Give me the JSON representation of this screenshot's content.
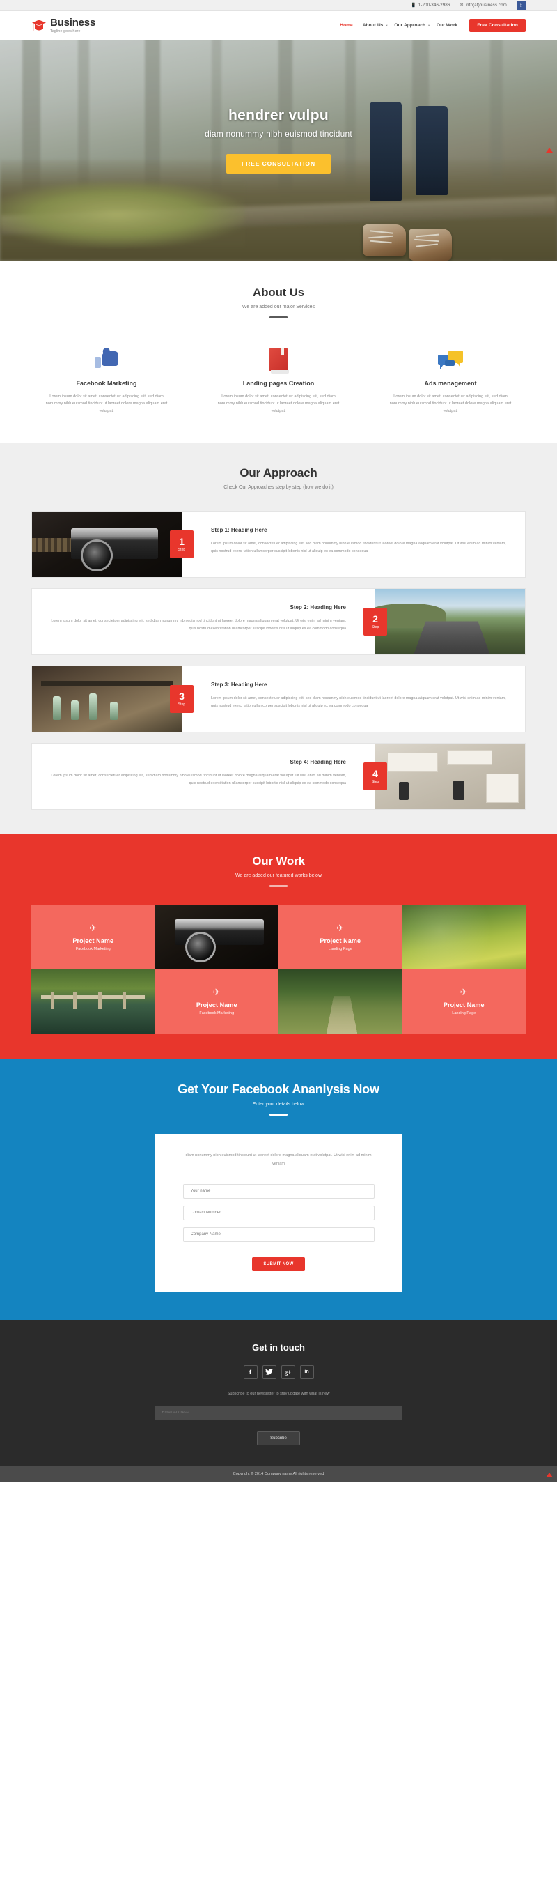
{
  "topbar": {
    "phone": "1-200-346-2986",
    "email": "info(at)business.com",
    "phone_icon": "mobile-icon",
    "email_icon": "envelope-icon",
    "facebook_icon": "f"
  },
  "header": {
    "brand_name": "Business",
    "tagline": "Tagline goes here",
    "nav": [
      {
        "label": "Home",
        "active": true,
        "caret": false
      },
      {
        "label": "About Us",
        "active": false,
        "caret": true
      },
      {
        "label": "Our Approach",
        "active": false,
        "caret": true
      },
      {
        "label": "Our Work",
        "active": false,
        "caret": false
      }
    ],
    "cta_label": "Free Consultation"
  },
  "hero": {
    "title": "hendrer vulpu",
    "subtitle": "diam nonummy nibh euismod tincidunt",
    "button": "FREE CONSULTATION"
  },
  "about": {
    "title": "About Us",
    "subtitle": "We are added our major Services",
    "columns": [
      {
        "icon": "thumbs-up-icon",
        "heading": "Facebook Marketing",
        "body": "Lorem ipsum dolor sit amet, consectetuer adipiscing elit, sed diam nonummy nibh euismod tincidunt ut laoreet dolore magna aliquam erat volutpat."
      },
      {
        "icon": "book-icon",
        "heading": "Landing pages Creation",
        "body": "Lorem ipsum dolor sit amet, consectetuer adipiscing elit, sed diam nonummy nibh euismod tincidunt ut laoreet dolore magna aliquam erat volutpat."
      },
      {
        "icon": "speech-bubbles-icon",
        "heading": "Ads management",
        "body": "Lorem ipsum dolor sit amet, consectetuer adipiscing elit, sed diam nonummy nibh euismod tincidunt ut laoreet dolore magna aliquam erat volutpat."
      }
    ]
  },
  "approach": {
    "title": "Our Approach",
    "subtitle": "Check Our Approaches step by step (how we do it)",
    "step_label": "Step",
    "steps": [
      {
        "number": "1",
        "heading": "Step 1: Heading Here",
        "body": "Lorem ipsum dolor sit amet, consectetuer adipiscing elit, sed diam nonummy nibh euismod tincidunt ut laoreet dolore magna aliquam erat volutpat. Ut wisi enim ad minim veniam, quis nostrud exerci tation ullamcorper suscipit lobortis nisl ut aliquip ex ea commodo consequa",
        "image": "vintage-camera-photo"
      },
      {
        "number": "2",
        "heading": "Step 2: Heading Here",
        "body": "Lorem ipsum dolor sit amet, consectetuer adipiscing elit, sed diam nonummy nibh euismod tincidunt ut laoreet dolore magna aliquam erat volutpat. Ut wisi enim ad minim veniam, quis nostrud exerci tation ullamcorper suscipit lobortis nisl ut aliquip ex ea commodo consequa",
        "image": "mountain-road-photo"
      },
      {
        "number": "3",
        "heading": "Step 3: Heading Here",
        "body": "Lorem ipsum dolor sit amet, consectetuer adipiscing elit, sed diam nonummy nibh euismod tincidunt ut laoreet dolore magna aliquam erat volutpat. Ut wisi enim ad minim veniam, quis nostrud exerci tation ullamcorper suscipit lobortis nisl ut aliquip ex ea commodo consequa",
        "image": "desk-workspace-photo"
      },
      {
        "number": "4",
        "heading": "Step 4: Heading Here",
        "body": "Lorem ipsum dolor sit amet, consectetuer adipiscing elit, sed diam nonummy nibh euismod tincidunt ut laoreet dolore magna aliquam erat volutpat. Ut wisi enim ad minim veniam, quis nostrud exerci tation ullamcorper suscipit lobortis nisl ut aliquip ex ea commodo consequa",
        "image": "office-desk-photo"
      }
    ]
  },
  "work": {
    "title": "Our Work",
    "subtitle": "We are added our featured works below",
    "plane_icon": "✈",
    "tiles": [
      {
        "type": "caption",
        "name": "Project Name",
        "category": "Facebook Marketing"
      },
      {
        "type": "photo",
        "image": "vintage-camera-photo"
      },
      {
        "type": "caption",
        "name": "Project Name",
        "category": "Landing Page"
      },
      {
        "type": "photo",
        "image": "green-moss-photo"
      },
      {
        "type": "photo",
        "image": "pond-fence-photo"
      },
      {
        "type": "caption",
        "name": "Project Name",
        "category": "Facebook Marketing"
      },
      {
        "type": "photo",
        "image": "forest-path-photo"
      },
      {
        "type": "caption",
        "name": "Project Name",
        "category": "Landing Page"
      }
    ]
  },
  "cta": {
    "title": "Get Your Facebook Ananlysis Now",
    "subtitle": "Enter your details below",
    "intro": "diam nonummy nibh euismod tincidunt ut laoreet dolore magna aliquam erat volutpat. Ut wisi enim ad minim veniam",
    "fields": [
      {
        "name": "your-name-input",
        "placeholder": "Your name",
        "value": ""
      },
      {
        "name": "contact-number-input",
        "placeholder": "Contact Number",
        "value": ""
      },
      {
        "name": "company-name-input",
        "placeholder": "Company Name",
        "value": ""
      }
    ],
    "submit_label": "SUBMIT NOW"
  },
  "footer": {
    "heading": "Get in touch",
    "socials": [
      {
        "icon": "facebook-icon",
        "glyph": "f"
      },
      {
        "icon": "twitter-icon",
        "glyph": "ᴠ"
      },
      {
        "icon": "google-plus-icon",
        "glyph": "g+"
      },
      {
        "icon": "linkedin-icon",
        "glyph": "in"
      }
    ],
    "newsletter_note": "Subscribe to our newsletter to stay update with what is new",
    "email_placeholder": "Email Address",
    "email_value": "",
    "subscribe_label": "Subcribe",
    "copyright": "Copyright © 2014 Company name All rights reserved"
  },
  "colors": {
    "brand_red": "#e8362c",
    "hero_yellow": "#fbc02d",
    "cta_blue": "#1484c0",
    "facebook_blue": "#3b5998",
    "footer_dark": "#2b2b2b"
  }
}
